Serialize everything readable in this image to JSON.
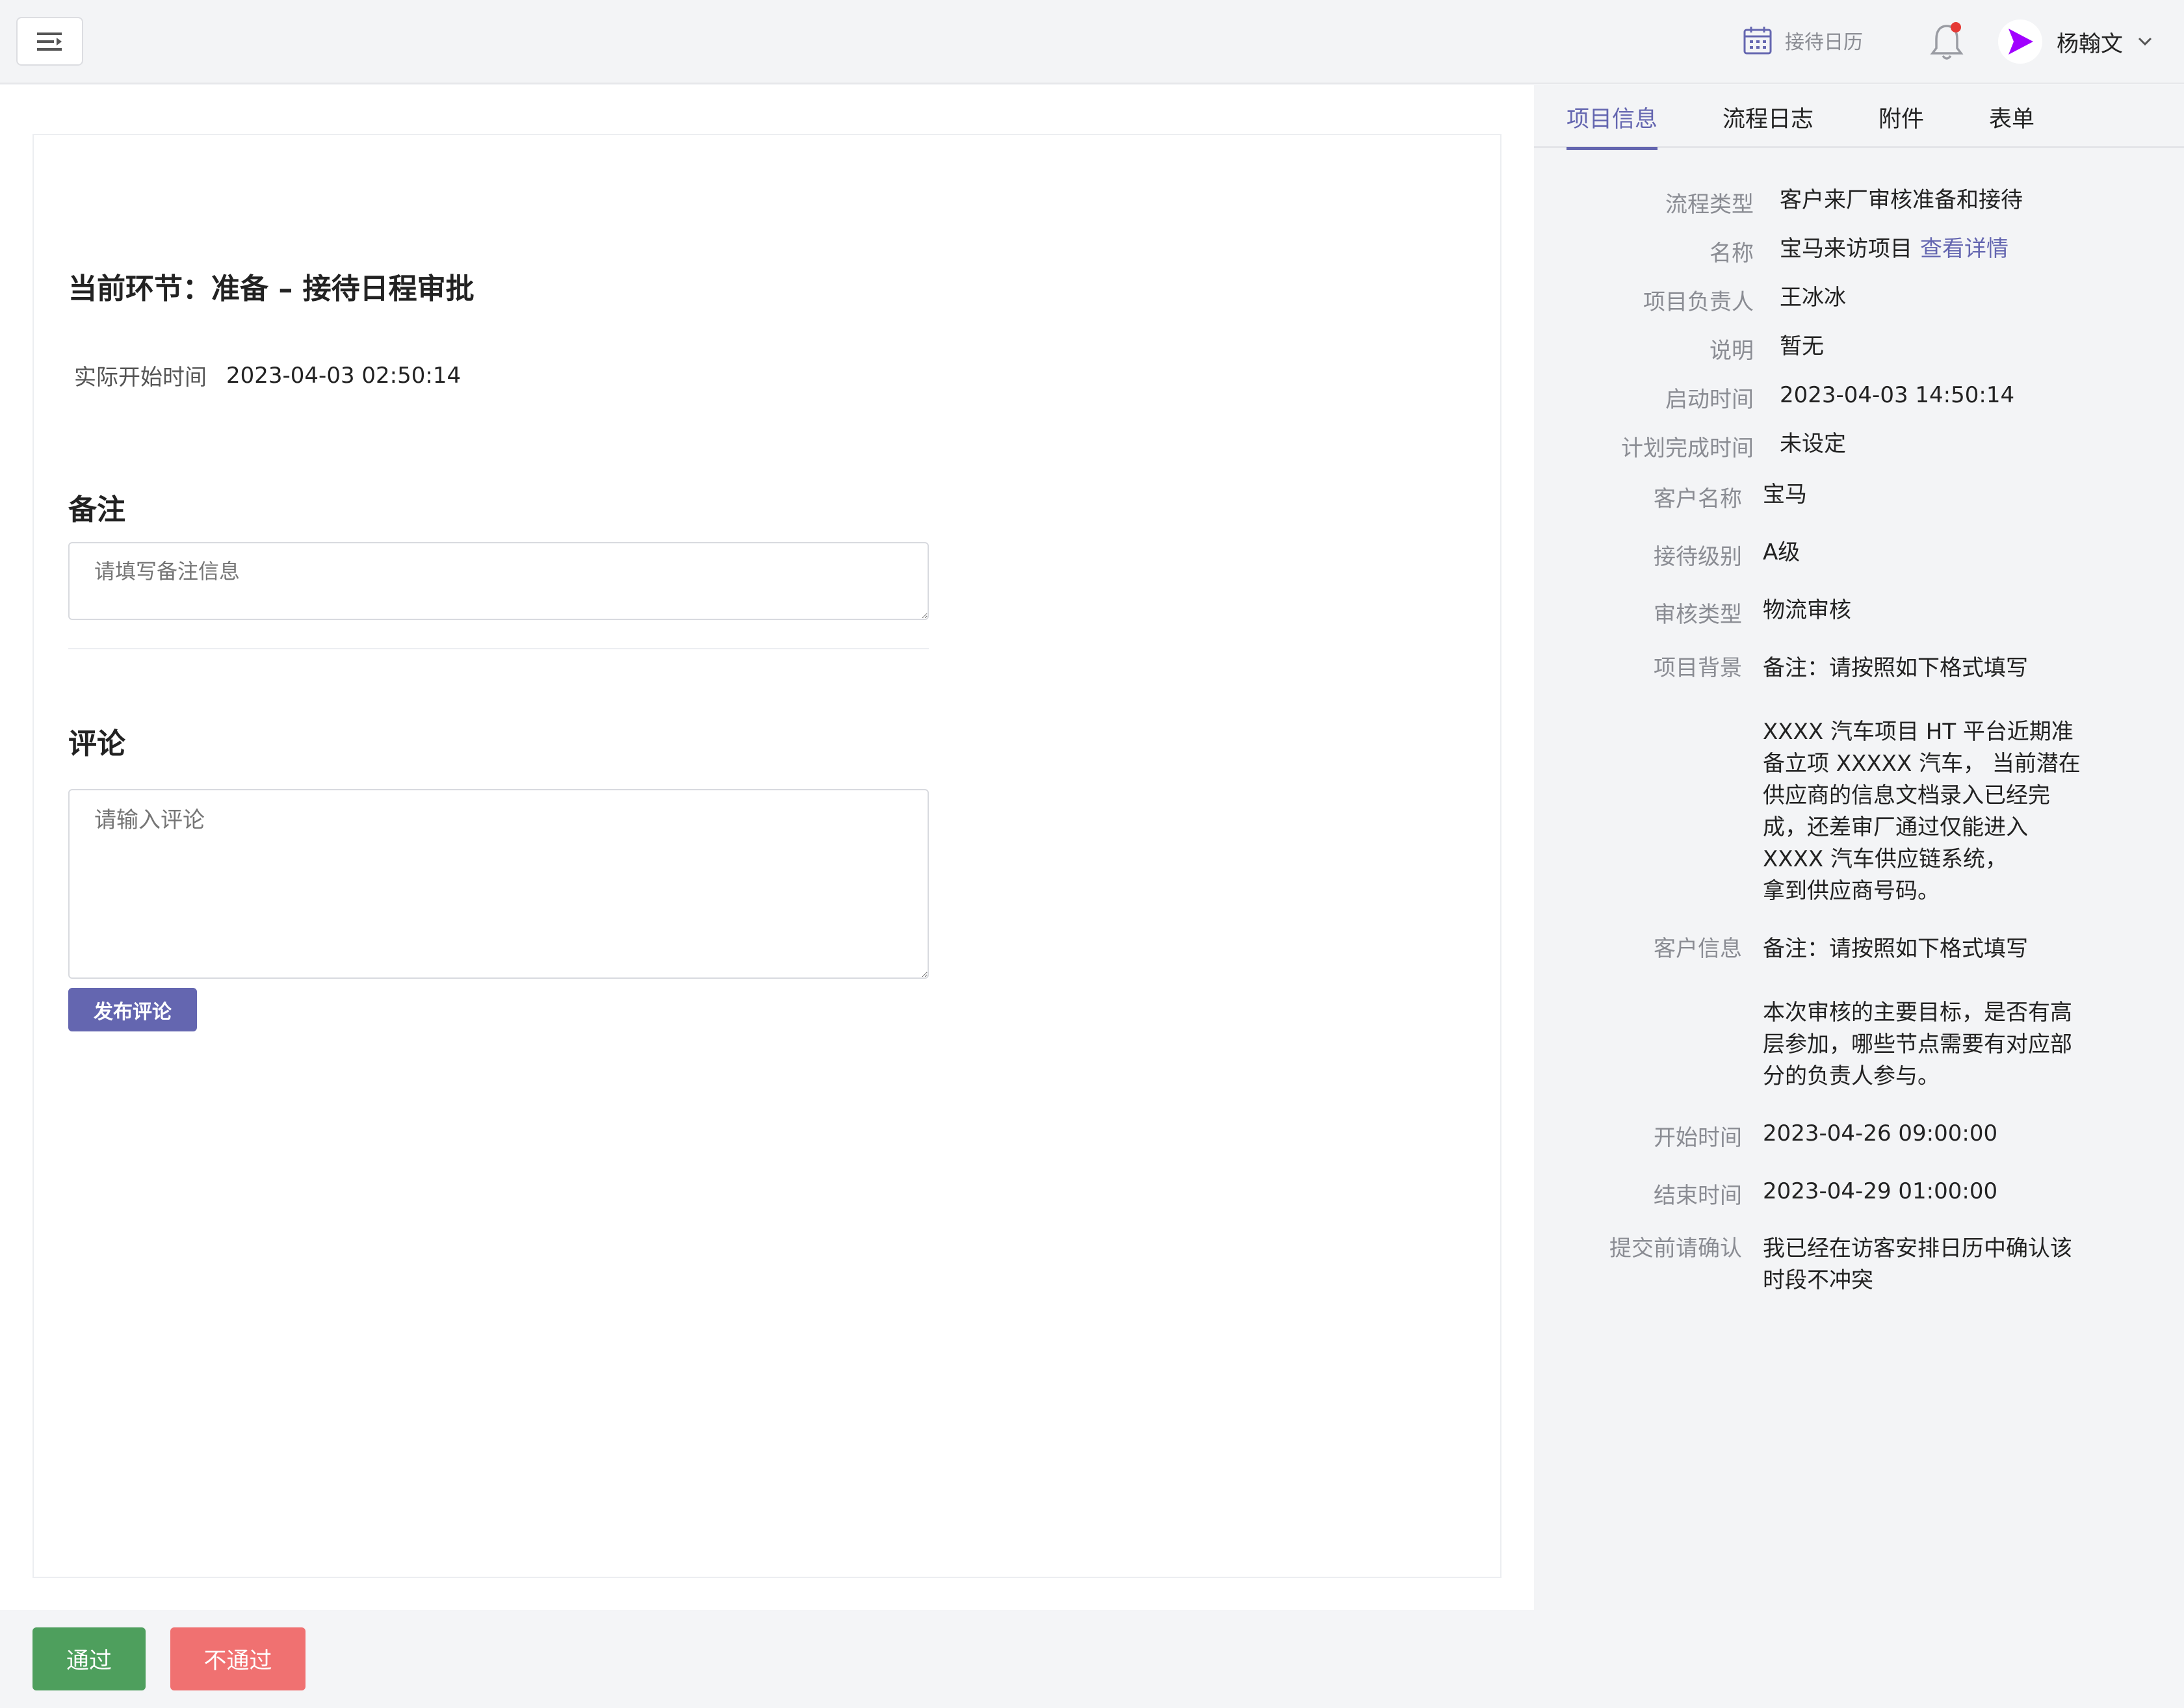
{
  "header": {
    "calendar_label": "接待日历",
    "user_name": "杨翰文"
  },
  "main": {
    "step_title": "当前环节：准备 – 接待日程审批",
    "start_time_label": "实际开始时间",
    "start_time_value": "2023-04-03 02:50:14",
    "remark_heading": "备注",
    "remark_placeholder": "请填写备注信息",
    "comment_heading": "评论",
    "comment_placeholder": "请输入评论",
    "publish_label": "发布评论"
  },
  "side": {
    "tabs": [
      "项目信息",
      "流程日志",
      "附件",
      "表单"
    ],
    "fields": [
      {
        "key": "流程类型",
        "value": "客户来厂审核准备和接待"
      },
      {
        "key": "名称",
        "value": "宝马来访项目",
        "link": "查看详情"
      },
      {
        "key": "项目负责人",
        "value": "王冰冰"
      },
      {
        "key": "说明",
        "value": "暂无"
      },
      {
        "key": "启动时间",
        "value": "2023-04-03 14:50:14"
      },
      {
        "key": "计划完成时间",
        "value": "未设定"
      },
      {
        "key": "客户名称",
        "value": "宝马"
      },
      {
        "key": "接待级别",
        "value": "A级"
      },
      {
        "key": "审核类型",
        "value": "物流审核"
      },
      {
        "key": "项目背景",
        "value": "备注：请按照如下格式填写\n\nXXXX 汽车项目 HT 平台近期准\n备立项 XXXXX 汽车， 当前潜在\n供应商的信息文档录入已经完\n成，还差审厂通过仅能进入\nXXXX 汽车供应链系统，\n拿到供应商号码。"
      },
      {
        "key": "客户信息",
        "value": "备注：请按照如下格式填写\n\n本次审核的主要目标，是否有高\n层参加，哪些节点需要有对应部\n分的负责人参与。"
      },
      {
        "key": "开始时间",
        "value": "2023-04-26 09:00:00"
      },
      {
        "key": "结束时间",
        "value": "2023-04-29 01:00:00"
      },
      {
        "key": "提交前请确认",
        "value": "我已经在访客安排日历中确认该\n时段不冲突"
      }
    ]
  },
  "footer": {
    "pass_label": "通过",
    "fail_label": "不通过"
  },
  "colors": {
    "accent": "#6466b0",
    "pass": "#4e9f5d",
    "fail": "#f07171"
  }
}
